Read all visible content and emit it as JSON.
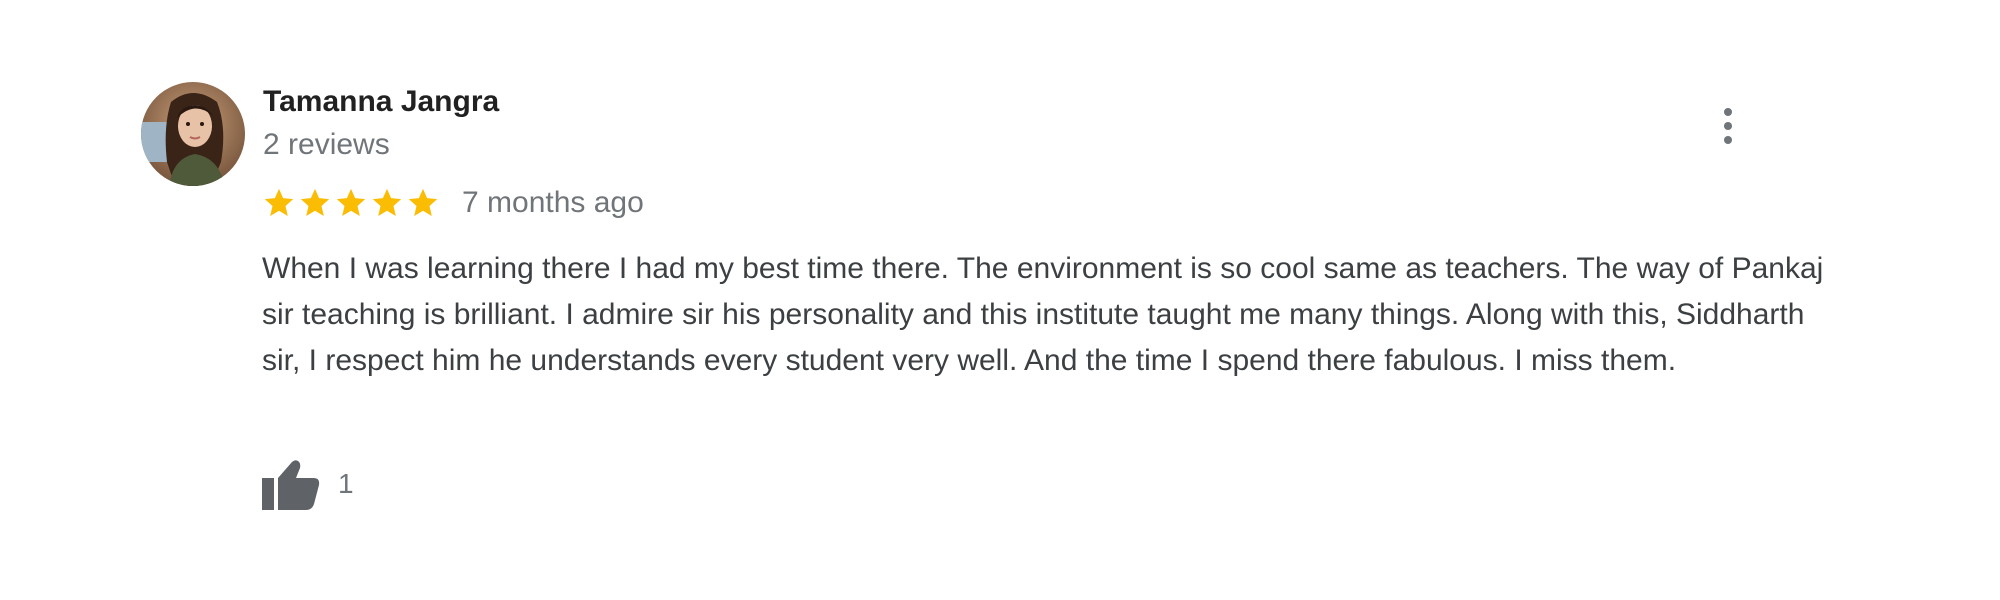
{
  "review": {
    "reviewer_name": "Tamanna Jangra",
    "review_count": "2 reviews",
    "rating": 5,
    "rating_max": 5,
    "time_ago": "7 months ago",
    "text": "When I was learning there I had my best time there. The environment is so cool same as teachers. The way of Pankaj sir teaching is brilliant. I admire sir his personality and this institute taught me many things. Along with this, Siddharth sir, I respect him he understands every student very well. And the time I spend there fabulous. I miss them.",
    "like_count": "1"
  },
  "icons": {
    "avatar": "profile-photo",
    "more": "more-vert-icon",
    "star": "star-icon",
    "like": "thumb-up-icon"
  },
  "colors": {
    "star": "#fbbc04",
    "name": "#212121",
    "secondary": "#70757a",
    "body_text": "#3c4043",
    "icon": "#5f6368"
  }
}
